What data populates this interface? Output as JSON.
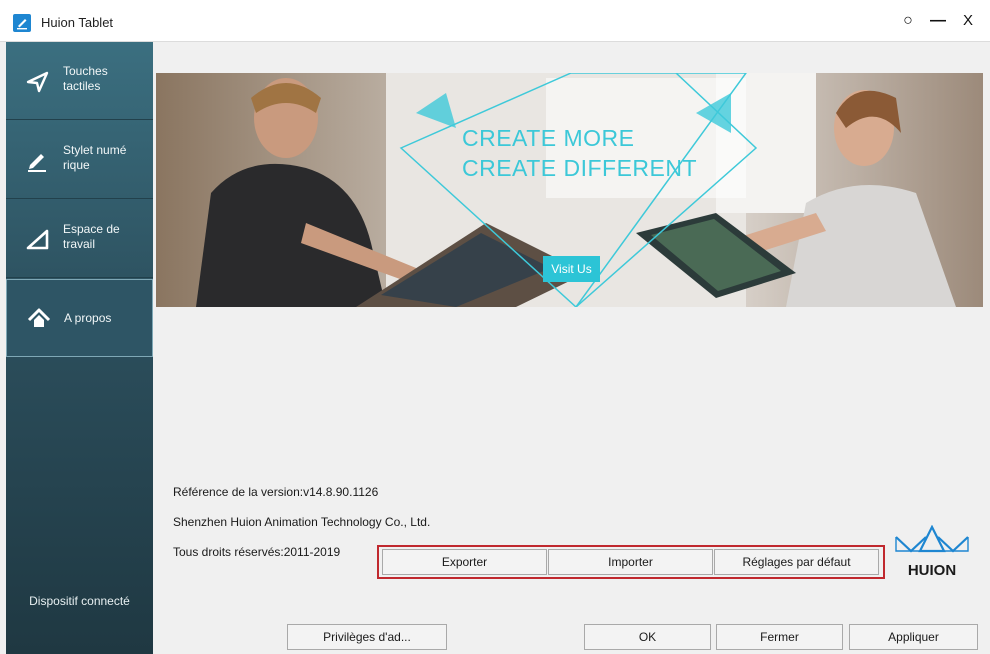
{
  "window": {
    "title": "Huion Tablet",
    "settings_icon": "○",
    "minimize_icon": "—",
    "close_icon": "X"
  },
  "sidebar": {
    "items": [
      {
        "label": "Touches\ntactiles",
        "icon": "touch-arrow-icon"
      },
      {
        "label": "Stylet numé\nrique",
        "icon": "pen-icon"
      },
      {
        "label": "Espace de\ntravail",
        "icon": "triangle-workspace-icon"
      },
      {
        "label": "A propos",
        "icon": "home-icon"
      }
    ],
    "active": "A propos",
    "device_status": "Dispositif connecté"
  },
  "banner": {
    "line1": "CREATE MORE",
    "line2": "CREATE DIFFERENT",
    "button": "Visit Us",
    "accent": "#2cc4d6"
  },
  "about": {
    "version": "Référence de la version:v14.8.90.1126",
    "company": "Shenzhen Huion Animation Technology Co., Ltd.",
    "rights": "Tous droits réservés:2011-2019"
  },
  "actions": {
    "export": "Exporter",
    "import": "Importer",
    "reset": "Réglages par défaut"
  },
  "footer": {
    "privileges": "Privilèges d'ad...",
    "ok": "OK",
    "close": "Fermer",
    "apply": "Appliquer"
  },
  "brand": {
    "logo_text": "HUION",
    "color": "#1e86d1"
  }
}
